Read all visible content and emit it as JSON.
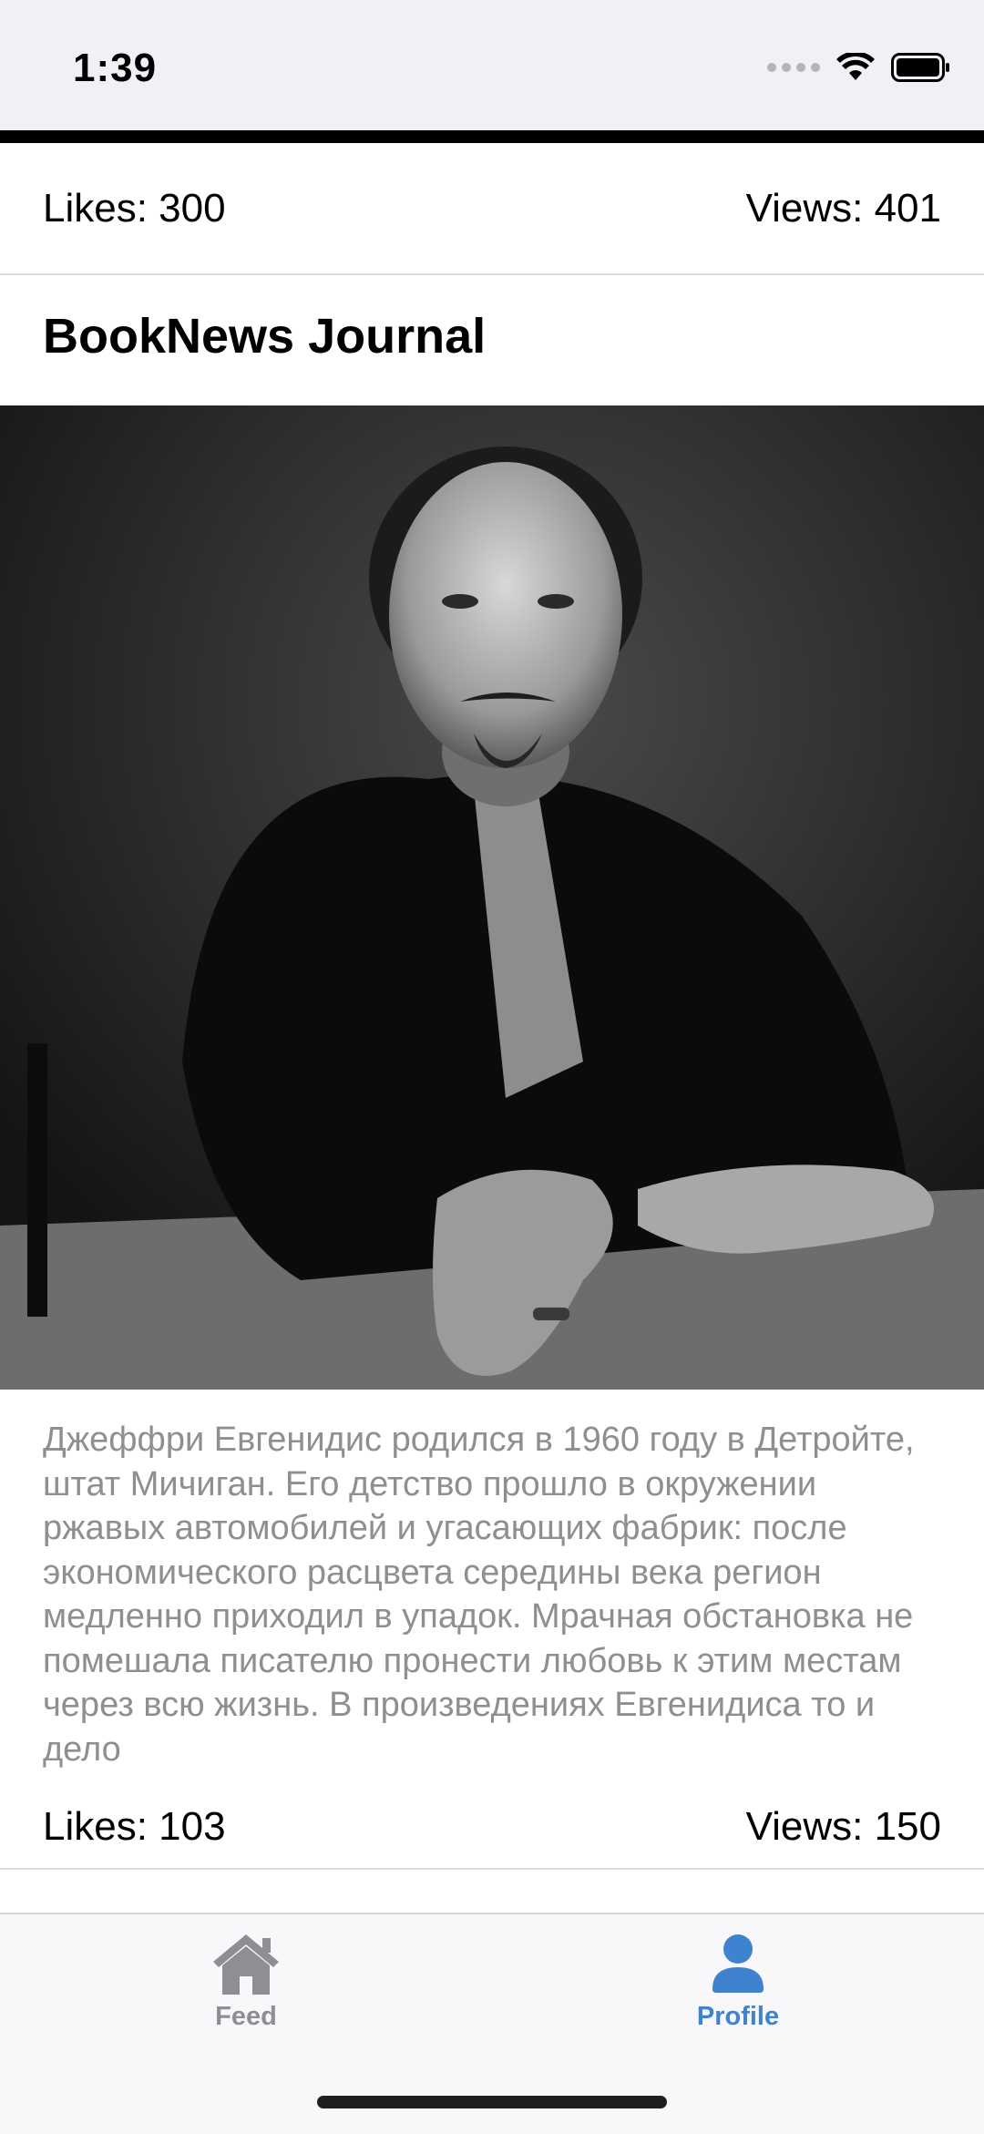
{
  "status_bar": {
    "time": "1:39"
  },
  "top_post": {
    "likes": "Likes: 300",
    "views": "Views: 401"
  },
  "post": {
    "title": "BookNews Journal",
    "image_alt": "Black and white portrait of a man sitting at a table",
    "description": "Джеффри Евгенидис родился в 1960 году в Детройте, штат Мичиган. Его детство прошло в окружении ржавых автомобилей и угасающих фабрик: после экономического расцвета середины века регион медленно приходил в упадок. Мрачная обстановка не помешала писателю пронести любовь к этим местам через всю жизнь. В произведениях Евгенидиса то и дело",
    "likes": "Likes: 103",
    "views": "Views: 150"
  },
  "tab_bar": {
    "tabs": [
      {
        "label": "Feed",
        "icon": "house-icon",
        "active": false
      },
      {
        "label": "Profile",
        "icon": "person-icon",
        "active": true
      }
    ],
    "active_color": "#3e82d0",
    "inactive_color": "#8e8e93"
  }
}
